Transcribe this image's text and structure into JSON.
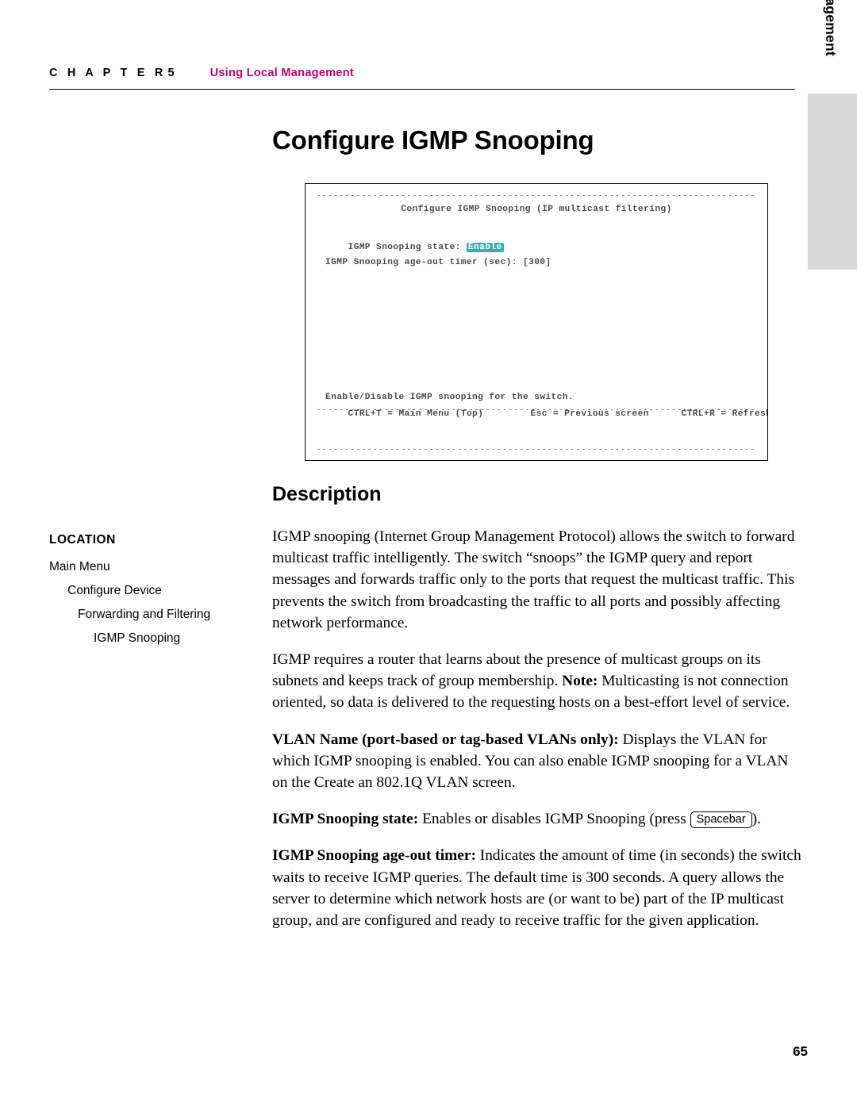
{
  "header": {
    "chapter_word": "C H A P T E R",
    "chapter_number": "5",
    "chapter_title": "Using Local Management",
    "accent_color": "#c2007b"
  },
  "side_tab": {
    "label": "Local Management",
    "background": "#d9d9d9"
  },
  "page_title": "Configure IGMP Snooping",
  "terminal": {
    "dash_line": "---------------------------------------------------------------------------------------------------------------------------",
    "title": "Configure IGMP Snooping (IP multicast filtering)",
    "line1_label": "IGMP Snooping state:",
    "line1_value": "Enable",
    "line2": "IGMP Snooping age-out timer (sec): [300]",
    "help_text": "Enable/Disable IGMP snooping for the switch.",
    "key_main_menu": "CTRL+T = Main Menu (Top)",
    "key_previous": "Esc = Previous screen",
    "key_refresh": "CTRL+R = Refresh",
    "highlight_color": "#28a8a8"
  },
  "location": {
    "title": "LOCATION",
    "items": [
      {
        "label": "Main Menu",
        "indent": 0
      },
      {
        "label": "Configure Device",
        "indent": 1
      },
      {
        "label": "Forwarding and Filtering",
        "indent": 2
      },
      {
        "label": "IGMP Snooping",
        "indent": 3
      }
    ]
  },
  "description": {
    "heading": "Description",
    "paragraph_1": "IGMP snooping (Internet Group Management Protocol) allows the switch to forward multicast traffic intelligently. The switch “snoops” the IGMP query and report messages and forwards traffic only to the ports that request the multicast traffic. This prevents the switch from broadcasting the traffic to all ports and possibly affecting network performance.",
    "paragraph_2_pre": "IGMP requires a router that learns about the presence of multicast groups on its subnets and keeps track of group membership. ",
    "paragraph_2_bold": "Note:",
    "paragraph_2_post": " Multicasting is not connection oriented, so data is delivered to the requesting hosts on a best-effort level of service.",
    "paragraph_3_bold": "VLAN Name (port-based or tag-based VLANs only):",
    "paragraph_3_post": " Displays the VLAN for which IGMP snooping is enabled. You can also enable IGMP snooping for a VLAN on the Create an 802.1Q VLAN screen.",
    "paragraph_4_bold": "IGMP Snooping state:",
    "paragraph_4_post": " Enables or disables IGMP Snooping (press ",
    "paragraph_4_key": "Spacebar",
    "paragraph_4_end": ").",
    "paragraph_5_bold": "IGMP Snooping age-out timer:",
    "paragraph_5_post": " Indicates the amount of time (in seconds) the switch waits to receive IGMP queries. The default time is 300 seconds. A query allows the server to determine which network hosts are (or want to be) part of the IP multicast group, and are configured and ready to receive traffic for the given application."
  },
  "page_number": "65"
}
